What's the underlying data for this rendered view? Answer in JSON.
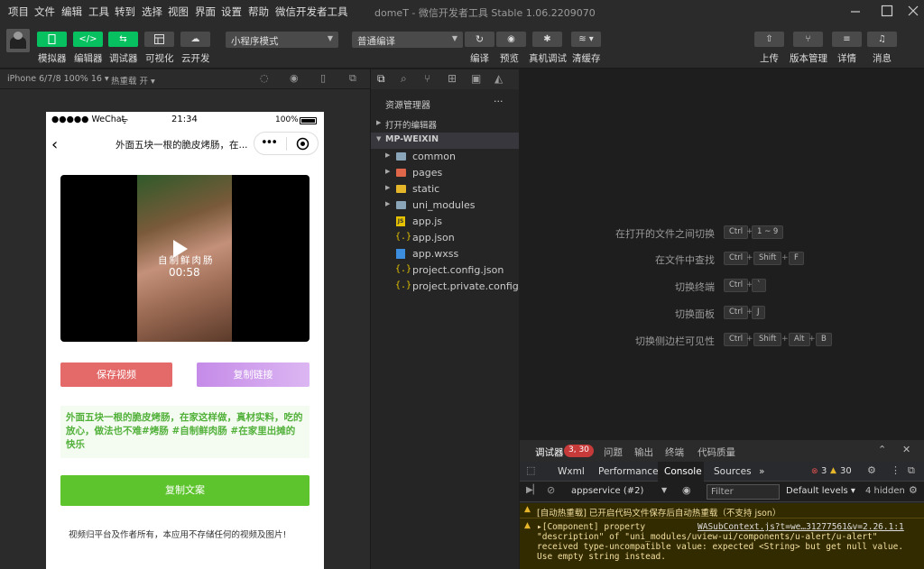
{
  "menubar": {
    "items": [
      "项目",
      "文件",
      "编辑",
      "工具",
      "转到",
      "选择",
      "视图",
      "界面",
      "设置",
      "帮助",
      "微信开发者工具"
    ],
    "window_title": "domeT - 微信开发者工具 Stable 1.06.2209070"
  },
  "toolbar": {
    "simulator": "模拟器",
    "editor": "编辑器",
    "debugger": "调试器",
    "visualize": "可视化",
    "cloud": "云开发",
    "mode_select": "小程序模式",
    "compile_select": "普通编译",
    "compile": "编译",
    "preview": "预览",
    "real_debug": "真机调试",
    "clear_cache": "清缓存",
    "upload": "上传",
    "version": "版本管理",
    "details": "详情",
    "messages": "消息"
  },
  "simulator": {
    "device": "iPhone 6/7/8 100% 16 ▾",
    "hot_reload": "热重载 开 ▾"
  },
  "phone": {
    "signal": "●●●●● WeChat",
    "time": "21:34",
    "battery_pct": "100%",
    "nav_title": "外面五块一根的脆皮烤肠，在...",
    "video_caption": "自制鲜肉肠",
    "video_time": "00:58",
    "save_video": "保存视频",
    "copy_link": "复制链接",
    "description": "外面五块一根的脆皮烤肠，在家这样做，真材实料，吃的放心，做法也不难#烤肠 #自制鲜肉肠 #在家里出摊的快乐",
    "copy_text": "复制文案",
    "disclaimer": "视频归平台及作者所有，本应用不存储任何的视频及图片!"
  },
  "explorer": {
    "title": "资源管理器",
    "more": "···",
    "open_editors": "打开的编辑器",
    "project": "MP-WEIXIN",
    "folders": [
      "common",
      "pages",
      "static",
      "uni_modules"
    ],
    "files": [
      "app.js",
      "app.json",
      "app.wxss",
      "project.config.json",
      "project.private.config.js..."
    ]
  },
  "shortcuts": [
    {
      "label": "在打开的文件之间切换",
      "keys": [
        "Ctrl",
        "1 ~ 9"
      ]
    },
    {
      "label": "在文件中查找",
      "keys": [
        "Ctrl",
        "Shift",
        "F"
      ]
    },
    {
      "label": "切换终端",
      "keys": [
        "Ctrl",
        "`"
      ]
    },
    {
      "label": "切换面板",
      "keys": [
        "Ctrl",
        "J"
      ]
    },
    {
      "label": "切换侧边栏可见性",
      "keys": [
        "Ctrl",
        "Shift",
        "Alt",
        "B"
      ]
    }
  ],
  "debugger": {
    "tab_debugger": "调试器",
    "badge": "3, 30",
    "tab_issues": "问题",
    "tab_output": "输出",
    "tab_terminal": "终端",
    "tab_quality": "代码质量",
    "console_tabs": [
      "Wxml",
      "Performance",
      "Console",
      "Sources"
    ],
    "errors": "3",
    "warnings": "30",
    "context": "appservice (#2)",
    "filter_placeholder": "Filter",
    "levels": "Default levels ▾",
    "hidden": "4 hidden",
    "msg1": "[自动热重载] 已开启代码文件保存后自动热重载（不支持 json）",
    "msg2_a": "▸[Component] property",
    "msg2_link": "WASubContext.js?t=we…31277561&v=2.26.1:1",
    "msg2_b": "\"description\" of \"uni_modules/uview-ui/components/u-alert/u-alert\"",
    "msg2_c": "received type-uncompatible value: expected <String> but get null value.",
    "msg2_d": "Use empty string instead."
  },
  "colors": {
    "wechat_green": "#07c160",
    "save_btn": "#e46a6a",
    "copy_btn": "#c58be8",
    "copy_text_btn": "#5ec42d",
    "desc_text": "#52b13b"
  }
}
